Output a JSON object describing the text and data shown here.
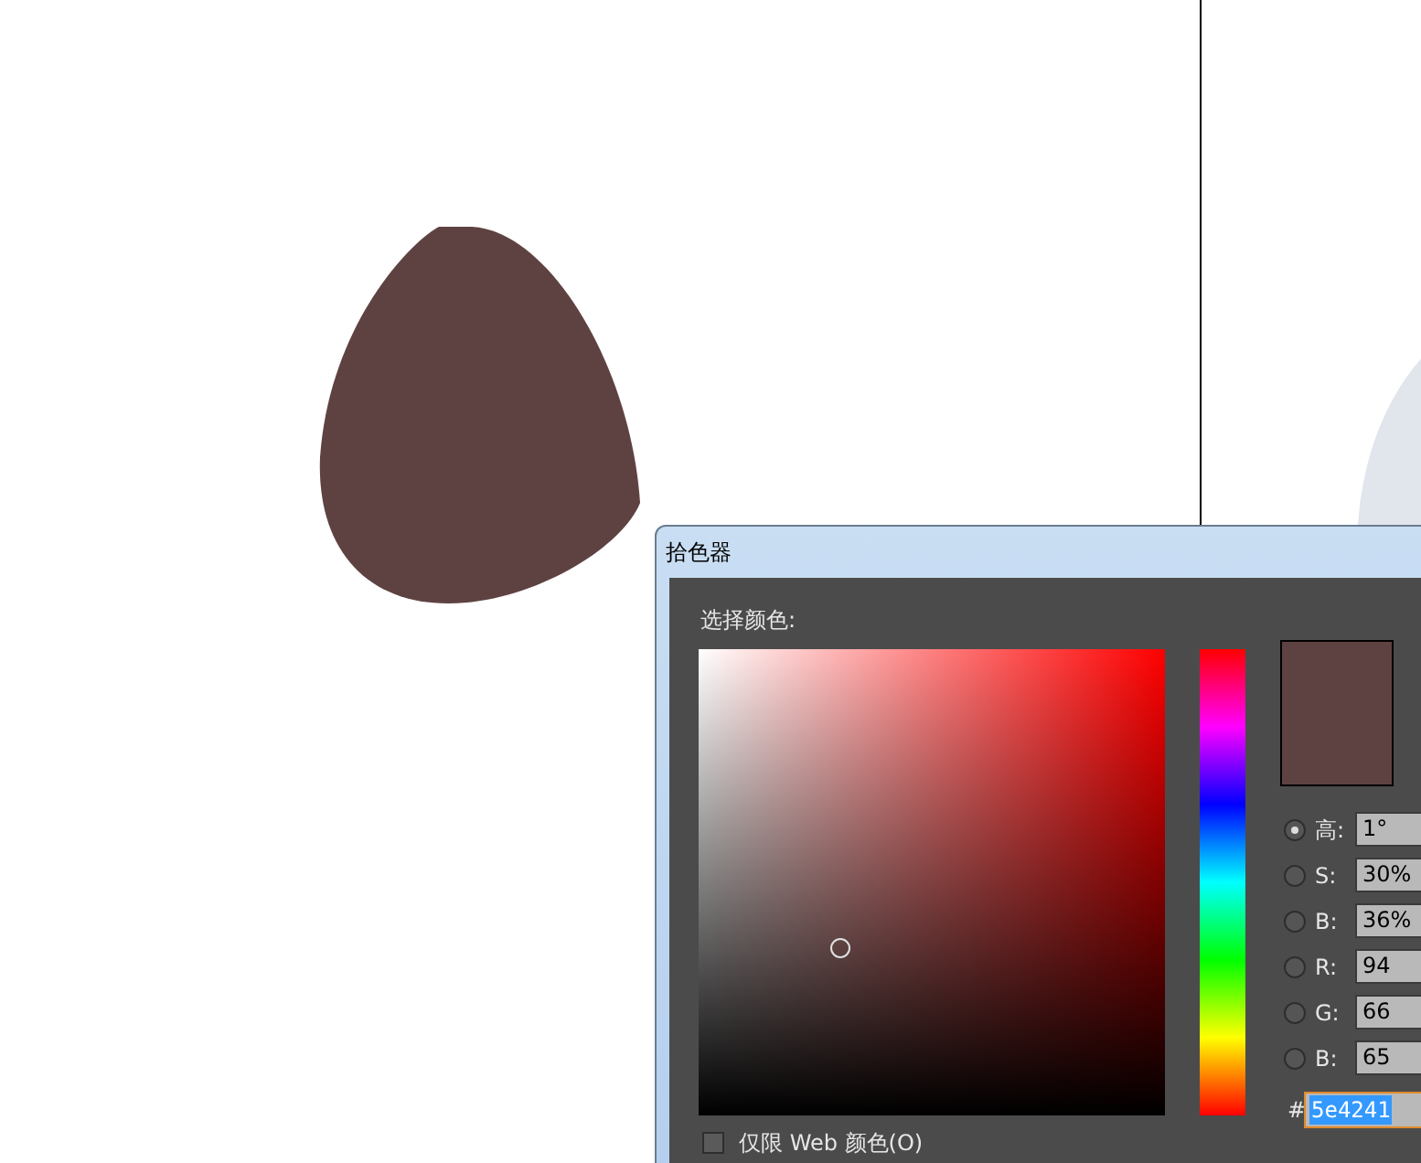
{
  "dialog": {
    "title": "拾色器",
    "prompt": "选择颜色:",
    "preview": {
      "color": "#5e4241"
    },
    "fields": [
      {
        "label": "高:",
        "value": "1°",
        "selected": true
      },
      {
        "label": "S:",
        "value": "30%",
        "selected": false
      },
      {
        "label": "B:",
        "value": "36%",
        "selected": false
      },
      {
        "label": "R:",
        "value": "94",
        "selected": false
      },
      {
        "label": "G:",
        "value": "66",
        "selected": false
      },
      {
        "label": "B:",
        "value": "65",
        "selected": false
      }
    ],
    "hex": {
      "label": "#",
      "value": "5e4241"
    },
    "web_only": {
      "label": "仅限 Web 颜色(O)",
      "checked": false
    }
  }
}
